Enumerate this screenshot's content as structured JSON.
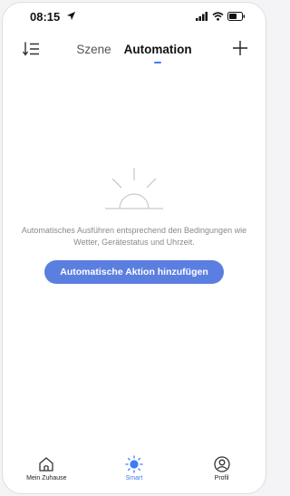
{
  "status_bar": {
    "time": "08:15"
  },
  "header": {
    "tabs": [
      {
        "label": "Szene",
        "active": false
      },
      {
        "label": "Automation",
        "active": true
      }
    ]
  },
  "empty_state": {
    "message": "Automatisches Ausführen entsprechend den Bedingungen wie Wetter, Gerätestatus und Uhrzeit.",
    "button_label": "Automatische Aktion hinzufügen"
  },
  "bottom_nav": {
    "items": [
      {
        "label": "Mein Zuhause",
        "icon": "home-icon",
        "active": false
      },
      {
        "label": "Smart",
        "icon": "sun-icon",
        "active": true
      },
      {
        "label": "Profil",
        "icon": "profile-icon",
        "active": false
      }
    ]
  },
  "colors": {
    "accent": "#5b7fe0",
    "active_nav": "#3d7cf4",
    "text_muted": "#8a8a8a",
    "icon_gray": "#bdbdbd"
  }
}
